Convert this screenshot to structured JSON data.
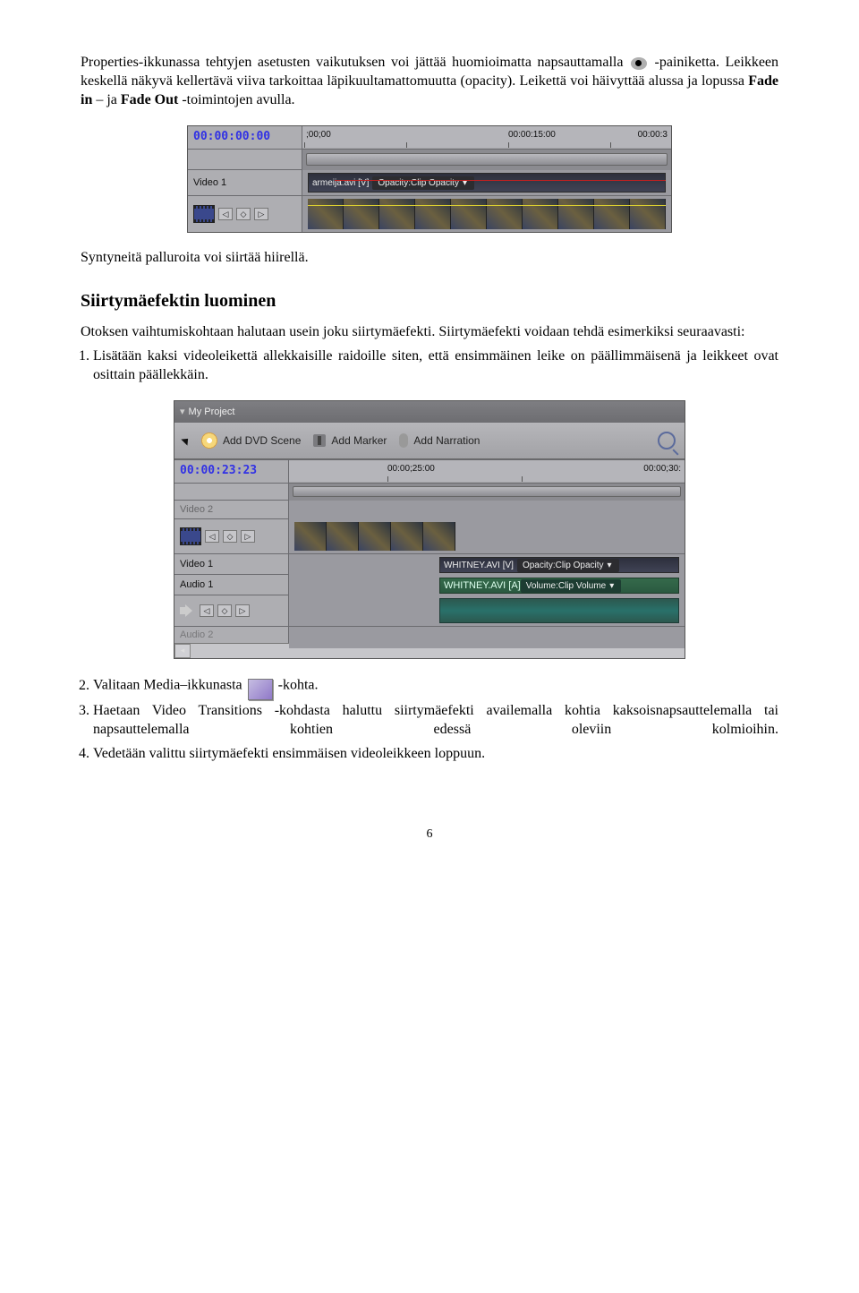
{
  "para1_a": "Properties-ikkunassa tehtyjen asetusten vaikutuksen voi jättää huomioimatta napsauttamalla ",
  "para1_b": " -painiketta. Leikkeen keskellä näkyvä kellertävä viiva tarkoittaa läpikuultamattomuutta (opacity). Leikettä voi häivyttää alussa ja lopussa ",
  "bold1": "Fade in",
  "mid1": " – ja ",
  "bold2": "Fade Out",
  "para1_c": " -toimintojen avulla.",
  "tl1": {
    "timecode": "00:00:00:00",
    "ruler_labels": [
      ";00;00",
      "00:00:15:00",
      "00:00:3"
    ],
    "track_label": "Video 1",
    "clip_text": "armeija.avi [V]",
    "opacity_text": "Opacity:Clip Opacity"
  },
  "para2": "Syntyneitä palluroita voi siirtää hiirellä.",
  "heading": "Siirtymäefektin luominen",
  "para3": "Otoksen vaihtumiskohtaan halutaan usein joku siirtymäefekti. Siirtymäefekti voidaan tehdä esimerkiksi seuraavasti:",
  "step1": "Lisätään kaksi videoleikettä allekkaisille raidoille siten, että ensimmäinen leike on päällimmäisenä ja leikkeet ovat osittain päällekkäin.",
  "tl2": {
    "project_title": "My Project",
    "toolbar": {
      "dvd": "Add DVD Scene",
      "marker": "Add Marker",
      "narration": "Add Narration"
    },
    "timecode": "00:00:23:23",
    "ruler_labels": [
      "00:00;25:00",
      "00:00;30:"
    ],
    "track_v2_label": "Video 2",
    "track_v1_label": "Video 1",
    "clip_v1_name": "WHITNEY.AVI [V]",
    "clip_v1_prop": "Opacity:Clip Opacity",
    "track_a1_label": "Audio 1",
    "clip_a1_name": "WHITNEY.AVI [A]",
    "clip_a1_prop": "Volume:Clip Volume",
    "track_a2_label": "Audio 2"
  },
  "step2_a": "Valitaan Media–ikkunasta ",
  "step2_b": "-kohta.",
  "step3": "Haetaan Video Transitions -kohdasta haluttu siirtymäefekti availemalla kohtia kaksoisnapsauttelemalla tai napsauttelemalla kohtien edessä oleviin kolmioihin.",
  "step4": "Vedetään valittu siirtymäefekti ensimmäisen videoleikkeen loppuun.",
  "page_number": "6"
}
